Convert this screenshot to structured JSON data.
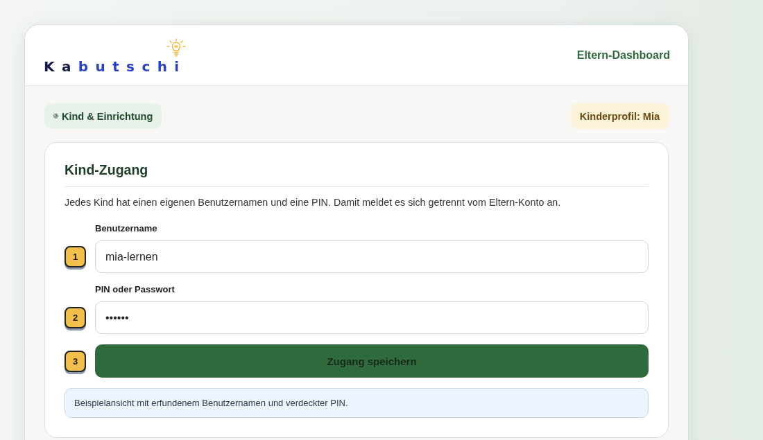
{
  "header": {
    "logo": {
      "parts": [
        {
          "text": "Ka",
          "color": "#141a4a"
        },
        {
          "text": "butschi",
          "color": "#2a44c6"
        }
      ]
    },
    "nav_link": "Eltern-Dashboard"
  },
  "toolbar": {
    "section_chip": "Kind & Einrichtung",
    "profile_badge": "Kinderprofil: Mia"
  },
  "card": {
    "title": "Kind-Zugang",
    "description": "Jedes Kind hat einen eigenen Benutzernamen und eine PIN. Damit meldet es sich getrennt vom Eltern-Konto an.",
    "steps": [
      {
        "number": "1",
        "kind": "field",
        "label": "Benutzername",
        "value": "mia-lernen"
      },
      {
        "number": "2",
        "kind": "field",
        "label": "PIN oder Passwort",
        "value": "••••••"
      },
      {
        "number": "3",
        "kind": "button",
        "label": "Zugang speichern"
      }
    ],
    "note": "Beispielansicht mit erfundenem Benutzernamen und verdeckter PIN."
  }
}
